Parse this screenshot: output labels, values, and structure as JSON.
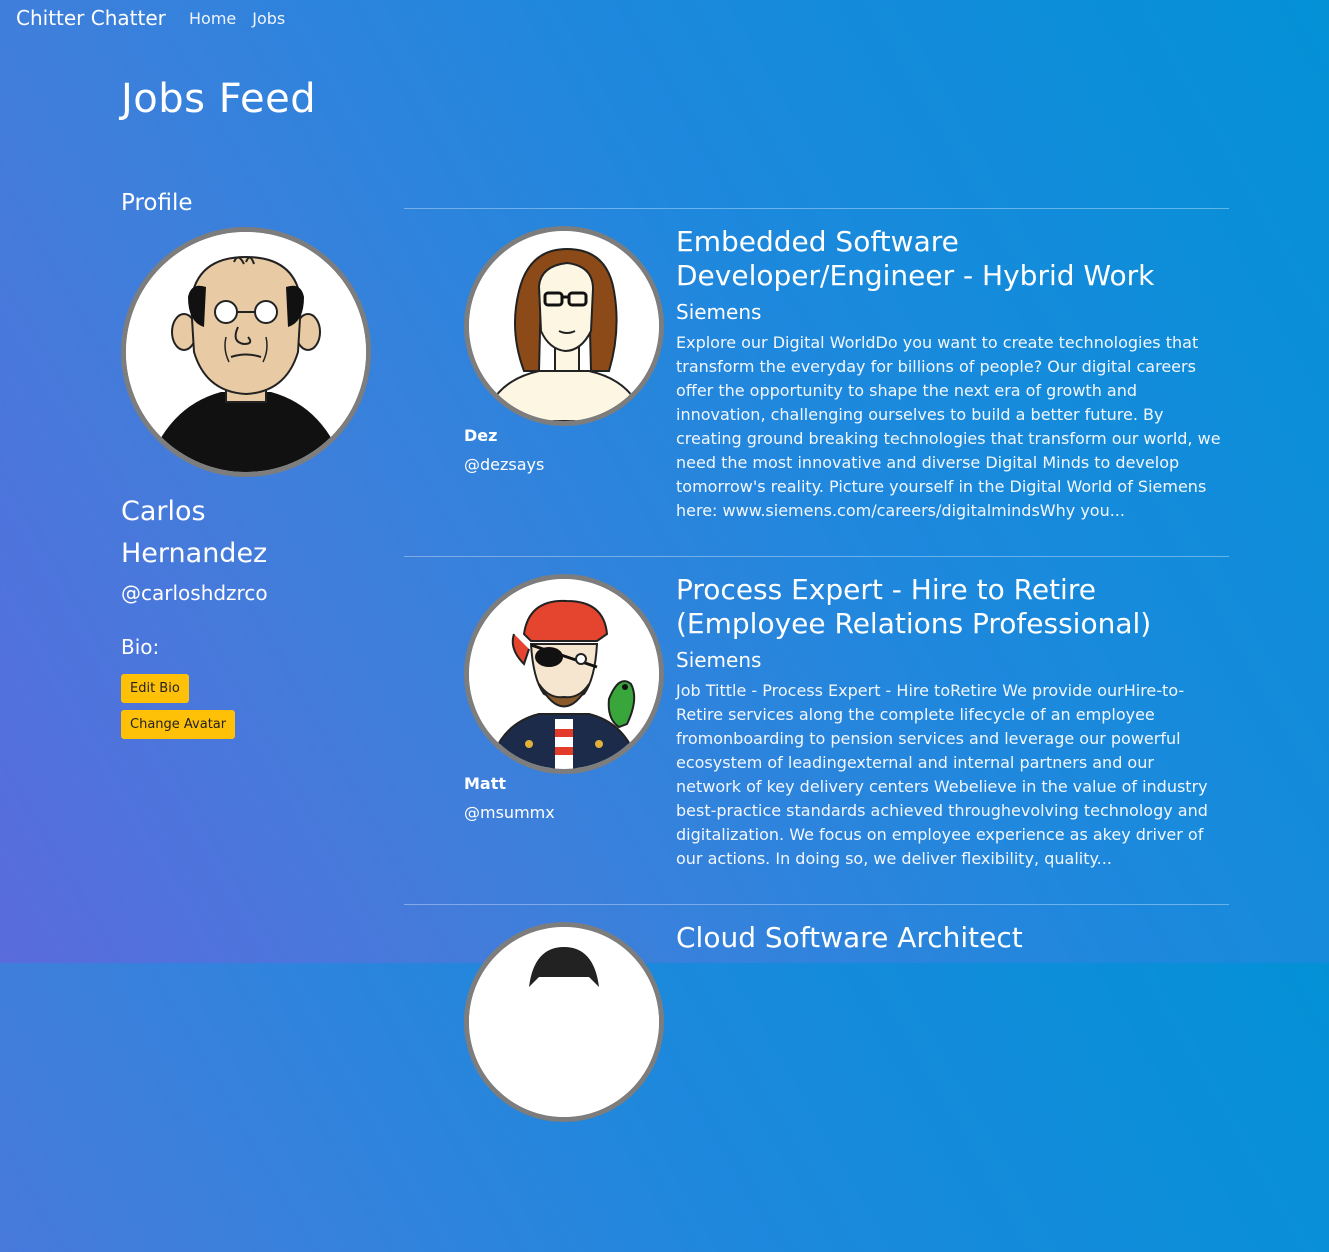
{
  "navbar": {
    "brand": "Chitter Chatter",
    "links": [
      "Home",
      "Jobs"
    ]
  },
  "page": {
    "title": "Jobs Feed"
  },
  "profile": {
    "heading": "Profile",
    "name": "Carlos Hernandez",
    "handle": "@carloshdzrco",
    "bio_label": "Bio:",
    "edit_bio_label": "Edit Bio",
    "change_avatar_label": "Change Avatar"
  },
  "posts": [
    {
      "user": "Dez",
      "handle": "@dezsays",
      "title": "Embedded Software Developer/Engineer - Hybrid Work",
      "company": "Siemens",
      "description": "Explore our Digital WorldDo you want to create technologies that transform the everyday for billions of people? Our digital careers offer the opportunity to shape the next era of growth and innovation, challenging ourselves to build a better future. By creating ground breaking technologies that transform our world, we need the most innovative and diverse Digital Minds to develop tomorrow's reality. Picture yourself in the Digital World of Siemens here: www.siemens.com/careers/digitalmindsWhy you..."
    },
    {
      "user": "Matt",
      "handle": "@msummx",
      "title": "Process Expert - Hire to Retire (Employee Relations Professional)",
      "company": "Siemens",
      "description": "Job Tittle - Process Expert - Hire toRetire We provide ourHire-to-Retire services along the complete lifecycle of an employee fromonboarding to pension services and leverage our powerful ecosystem of leadingexternal and internal partners and our network of key delivery centers Webelieve in the value of industry best-practice standards achieved throughevolving technology and digitalization. We focus on employee experience as akey driver of our actions. In doing so, we deliver flexibility, quality..."
    },
    {
      "title": "Cloud Software Architect"
    }
  ]
}
